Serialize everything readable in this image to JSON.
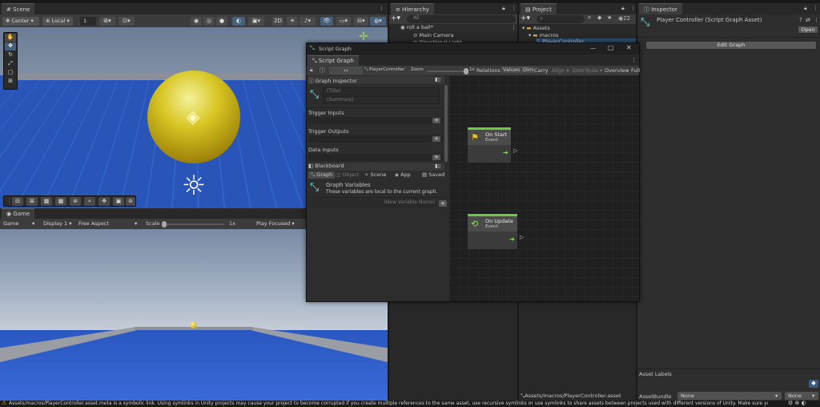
{
  "scene": {
    "tab": "Scene",
    "pivot": "Center",
    "space": "Local",
    "snap": "1",
    "mode2d": "2D",
    "gizmo_count": "1"
  },
  "hierarchy": {
    "tab": "Hierarchy",
    "search_placeholder": "All",
    "root": "roll a ball*",
    "items": [
      "Main Camera",
      "Directional Light"
    ]
  },
  "project": {
    "tab": "Project",
    "count": "22",
    "assets": "Assets",
    "folders": [
      "macros",
      "PlayerController"
    ],
    "path": "Assets/macros/PlayerController.asset"
  },
  "inspector": {
    "tab": "Inspector",
    "title": "Player Controller (Script Graph Asset)",
    "open": "Open",
    "edit": "Edit Graph",
    "asset_labels": "Asset Labels",
    "asset_bundle": "AssetBundle",
    "bundle_value": "None",
    "variant_value": "None"
  },
  "script_graph": {
    "window_title": "Script Graph",
    "tab": "Script Graph",
    "breadcrumb": "PlayerController",
    "zoom_label": "Zoom",
    "zoom_value": "1x",
    "zoom_level": 1,
    "toolbar": [
      "Relations",
      "Values",
      "Dim",
      "Carry",
      "Align",
      "Distribute",
      "Overview",
      "Full"
    ],
    "graph_inspector": {
      "header": "Graph Inspector",
      "title_placeholder": "(Title)",
      "summary_placeholder": "(Summary)",
      "trigger_inputs": "Trigger Inputs",
      "trigger_outputs": "Trigger Outputs",
      "data_inputs": "Data Inputs"
    },
    "blackboard": {
      "header": "Blackboard",
      "tabs": [
        "Graph",
        "Object",
        "Scene",
        "App",
        "Saved"
      ],
      "vars_title": "Graph Variables",
      "vars_desc": "These variables are local to the current graph.",
      "new_var_placeholder": "(New Variable Name)"
    },
    "nodes": [
      {
        "title": "On Start",
        "subtitle": "Event"
      },
      {
        "title": "On Update",
        "subtitle": "Event"
      }
    ]
  },
  "game": {
    "tab": "Game",
    "mode": "Game",
    "display": "Display 1",
    "aspect": "Free Aspect",
    "scale_label": "Scale",
    "scale_value": "1x",
    "scale_level": 1,
    "play": "Play Focused"
  },
  "console": {
    "message": "Assets/macros/PlayerController.asset.meta is a symbolic link. Using symlinks in Unity projects may cause your project to become corrupted if you create multiple references to the same asset, use recursive symlinks or use symlinks to share assets between projects used with different versions of Unity. Make sure you"
  }
}
